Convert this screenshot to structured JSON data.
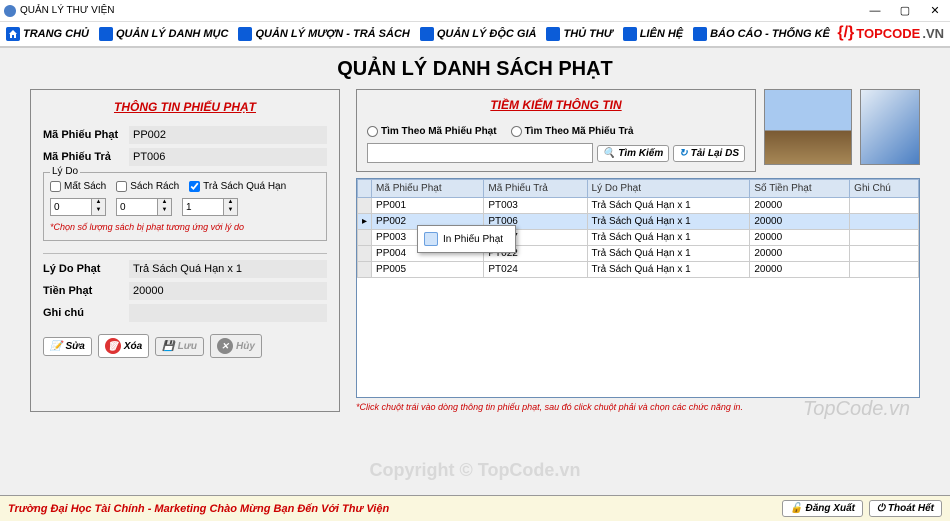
{
  "window": {
    "title": "QUẢN LÝ THƯ VIỆN"
  },
  "menu": {
    "items": [
      "TRANG CHỦ",
      "QUẢN LÝ DANH MỤC",
      "QUẢN LÝ MƯỢN - TRẢ SÁCH",
      "QUẢN LÝ ĐỘC GIẢ",
      "THỦ THƯ",
      "LIÊN HỆ",
      "BÁO CÁO - THỐNG KÊ"
    ]
  },
  "brand": {
    "name": "TOPCODE",
    "suffix": ".VN"
  },
  "page_title": "QUẢN LÝ DANH SÁCH PHẠT",
  "form": {
    "title": "THÔNG TIN PHIẾU PHẠT",
    "ma_phieu_phat_label": "Mã Phiếu Phạt",
    "ma_phieu_phat": "PP002",
    "ma_phieu_tra_label": "Mã Phiếu Trả",
    "ma_phieu_tra": "PT006",
    "reason_legend": "Lý Do",
    "chk_mat_sach": "Mất Sách",
    "chk_sach_rach": "Sách Rách",
    "chk_qua_han": "Trả Sách Quá Hạn",
    "num1": "0",
    "num2": "0",
    "num3": "1",
    "note": "*Chọn số lượng sách bị phạt tương ứng với lý do",
    "ly_do_phat_label": "Lý Do Phạt",
    "ly_do_phat": "Trả Sách Quá Hạn x 1",
    "tien_phat_label": "Tiền Phạt",
    "tien_phat": "20000",
    "ghi_chu_label": "Ghi chú",
    "ghi_chu": "",
    "btn_sua": "Sửa",
    "btn_xoa": "Xóa",
    "btn_luu": "Lưu",
    "btn_huy": "Hủy"
  },
  "search": {
    "title": "TIỀM KIẾM THÔNG TIN",
    "radio1": "Tìm Theo Mã Phiếu Phạt",
    "radio2": "Tìm Theo Mã Phiếu Trả",
    "btn_search": "Tìm Kiếm",
    "btn_reload": "Tải Lại DS"
  },
  "grid": {
    "headers": [
      "Mã Phiếu Phạt",
      "Mã Phiếu Trả",
      "Lý Do Phạt",
      "Số Tiền Phạt",
      "Ghi Chú"
    ],
    "rows": [
      [
        "PP001",
        "PT003",
        "Trả Sách Quá Hạn x 1",
        "20000",
        ""
      ],
      [
        "PP002",
        "PT006",
        "Trả Sách Quá Hạn x 1",
        "20000",
        ""
      ],
      [
        "PP003",
        "PT017",
        "Trả Sách Quá Hạn x 1",
        "20000",
        ""
      ],
      [
        "PP004",
        "PT022",
        "Trả Sách Quá Hạn x 1",
        "20000",
        ""
      ],
      [
        "PP005",
        "PT024",
        "Trả Sách Quá Hạn x 1",
        "20000",
        ""
      ]
    ],
    "context_menu": "In Phiếu Phạt"
  },
  "hint": "*Click chuột trái vào dòng thông tin phiếu phạt, sau đó click chuột phải và chọn các chức năng in.",
  "watermark": "TopCode.vn",
  "watermark2": "Copyright © TopCode.vn",
  "footer": {
    "text": "Trường Đại Học Tài Chính - Marketing Chào Mừng Bạn Đến Với Thư Viện",
    "logout": "Đăng Xuất",
    "exit": "Thoát Hết"
  }
}
